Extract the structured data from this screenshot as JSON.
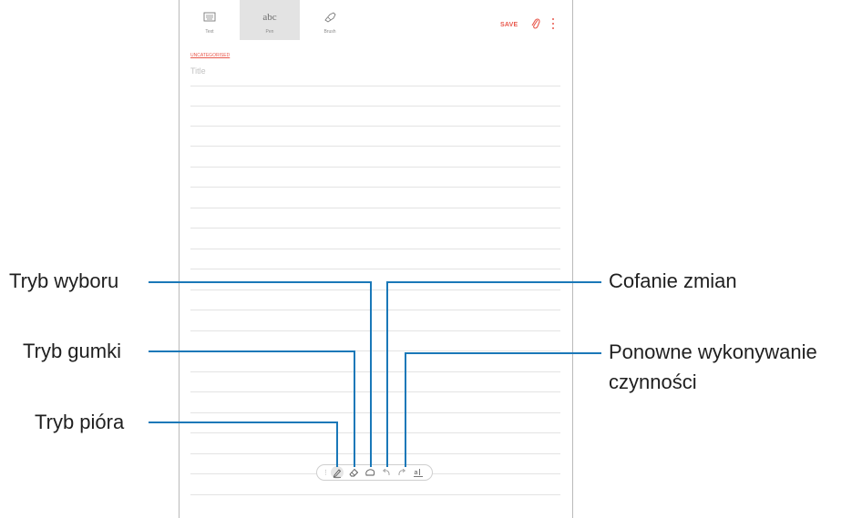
{
  "toolbar": {
    "modes": [
      {
        "icon": "keyboard-icon",
        "label": "Text",
        "active": false
      },
      {
        "icon": "handwriting-icon",
        "glyph": "abc",
        "label": "Pen",
        "active": true
      },
      {
        "icon": "brush-icon",
        "label": "Brush",
        "active": false
      }
    ],
    "save_label": "SAVE",
    "accent_color": "#e8584c"
  },
  "note": {
    "category": "UNCATEGORISED",
    "title_placeholder": "Title"
  },
  "pen_toolbar": {
    "tools": [
      "pen-icon",
      "eraser-icon",
      "selection-icon",
      "undo-icon",
      "redo-icon",
      "convert-text-icon"
    ]
  },
  "callouts": {
    "selection_mode": "Tryb wyboru",
    "eraser_mode": "Tryb gumki",
    "pen_mode": "Tryb pióra",
    "undo": "Cofanie zmian",
    "redo_line1": "Ponowne wykonywanie",
    "redo_line2": "czynności"
  },
  "connector_color": "#1a78b8"
}
